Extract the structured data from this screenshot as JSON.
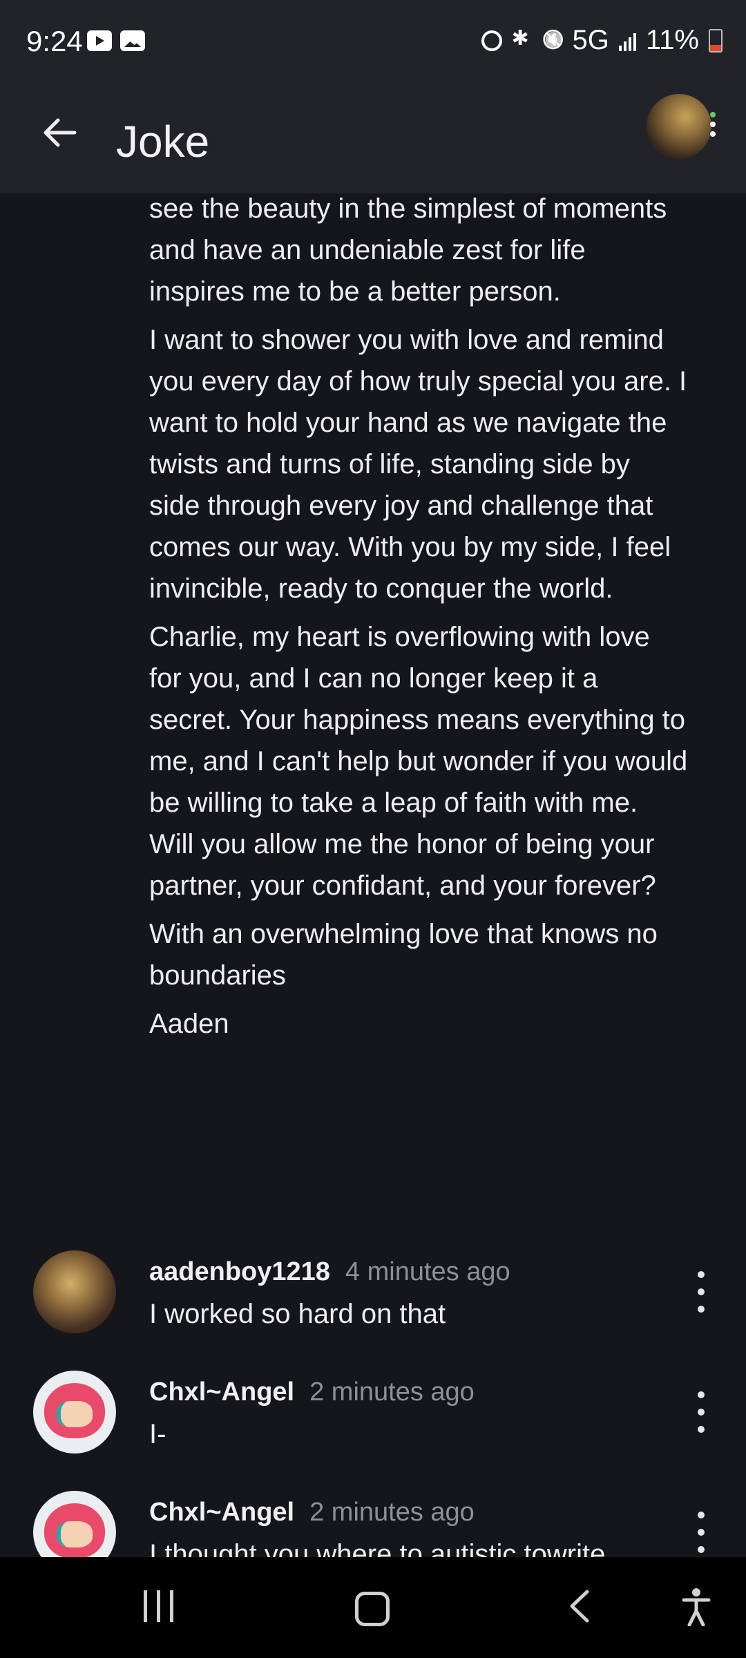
{
  "status_bar": {
    "time": "9:24",
    "network": "5G",
    "battery": "11%",
    "icons": [
      "youtube-icon",
      "photo-icon",
      "alarm-icon",
      "bluetooth-icon",
      "mute-icon",
      "signal-icon",
      "battery-icon"
    ]
  },
  "header": {
    "title": "Joke"
  },
  "post": {
    "paragraphs": [
      "see the beauty in the simplest of moments and have an undeniable zest for life inspires me to be a better person.",
      "I want to shower you with love and remind you every day of how truly special you are. I want to hold your hand as we navigate the twists and turns of life, standing side by side through every joy and challenge that comes our way. With you by my side, I feel invincible, ready to conquer the world.",
      "Charlie, my heart is overflowing with love for you, and I can no longer keep it a secret. Your happiness means everything to me, and I can't help but wonder if you would be willing to take a leap of faith with me. Will you allow me the honor of being your partner, your confidant, and your forever?",
      "With an overwhelming love that knows no boundaries",
      "Aaden"
    ]
  },
  "comments": [
    {
      "username": "aadenboy1218",
      "time": "4 minutes ago",
      "text": "I worked so hard on that"
    },
    {
      "username": "Chxl~Angel",
      "time": "2 minutes ago",
      "text": "I-"
    },
    {
      "username": "Chxl~Angel",
      "time": "2 minutes ago",
      "text": "I thought you where to autistic towrite"
    }
  ],
  "colors": {
    "background": "#15161b",
    "bar": "#222328",
    "muted_text": "#8f9096"
  }
}
